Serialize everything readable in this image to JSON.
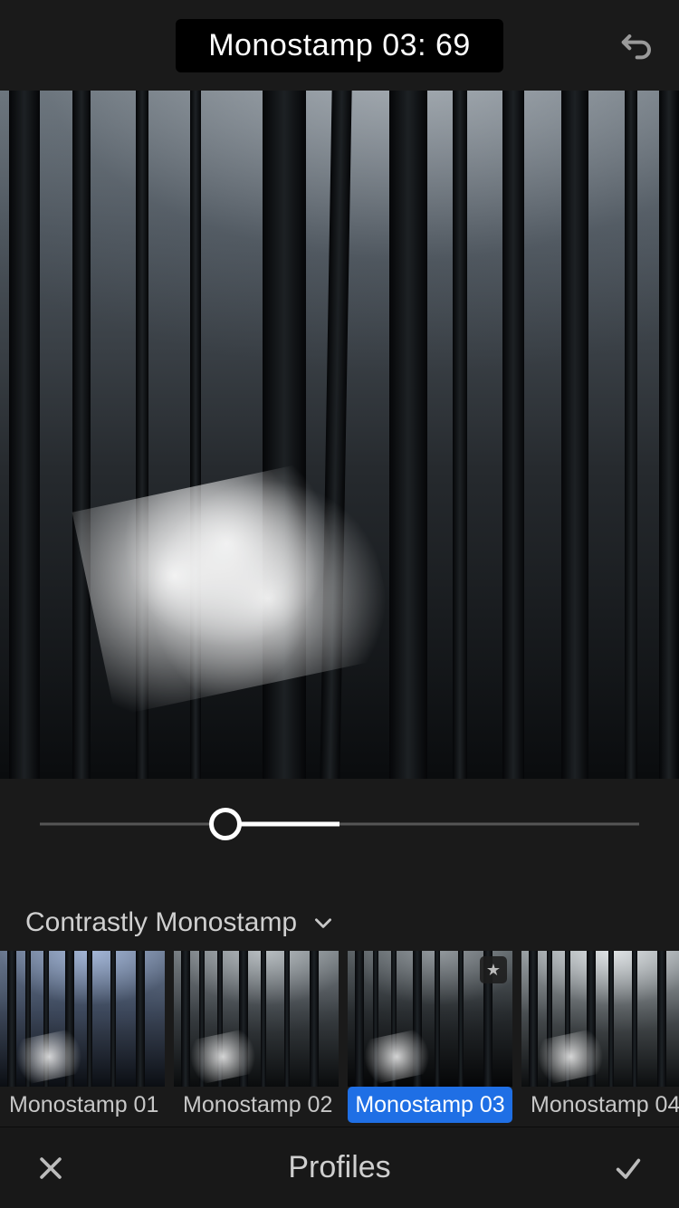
{
  "header": {
    "title": "Monostamp 03: 69"
  },
  "slider": {
    "value": 69,
    "min": 0,
    "max": 200,
    "default_position_pct": 31,
    "fill_end_pct": 50
  },
  "category": {
    "label": "Contrastly Monostamp"
  },
  "presets": [
    {
      "label": "Monostamp 01",
      "selected": false,
      "favorite": false,
      "tone": "cool"
    },
    {
      "label": "Monostamp 02",
      "selected": false,
      "favorite": false,
      "tone": "neutral"
    },
    {
      "label": "Monostamp 03",
      "selected": true,
      "favorite": true,
      "tone": "dark"
    },
    {
      "label": "Monostamp 04",
      "selected": false,
      "favorite": false,
      "tone": "light"
    }
  ],
  "footer": {
    "title": "Profiles"
  },
  "icons": {
    "undo": "undo-icon",
    "chevron": "chevron-down-icon",
    "close": "close-icon",
    "check": "check-icon",
    "star": "star-icon"
  }
}
